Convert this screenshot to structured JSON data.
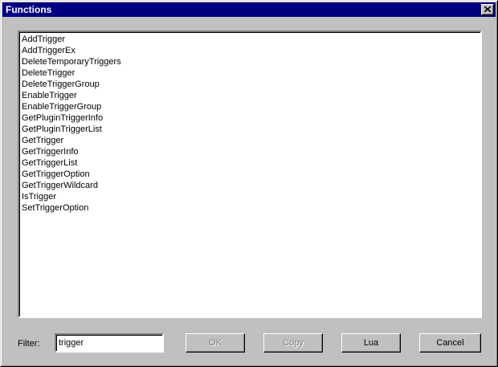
{
  "window": {
    "title": "Functions"
  },
  "functions": [
    "AddTrigger",
    "AddTriggerEx",
    "DeleteTemporaryTriggers",
    "DeleteTrigger",
    "DeleteTriggerGroup",
    "EnableTrigger",
    "EnableTriggerGroup",
    "GetPluginTriggerInfo",
    "GetPluginTriggerList",
    "GetTrigger",
    "GetTriggerInfo",
    "GetTriggerList",
    "GetTriggerOption",
    "GetTriggerWildcard",
    "IsTrigger",
    "SetTriggerOption"
  ],
  "filter": {
    "label": "Filter:",
    "value": "trigger"
  },
  "buttons": {
    "ok": "OK",
    "copy": "Copy",
    "lua": "Lua",
    "cancel": "Cancel"
  },
  "icons": {
    "close": "close-icon"
  }
}
